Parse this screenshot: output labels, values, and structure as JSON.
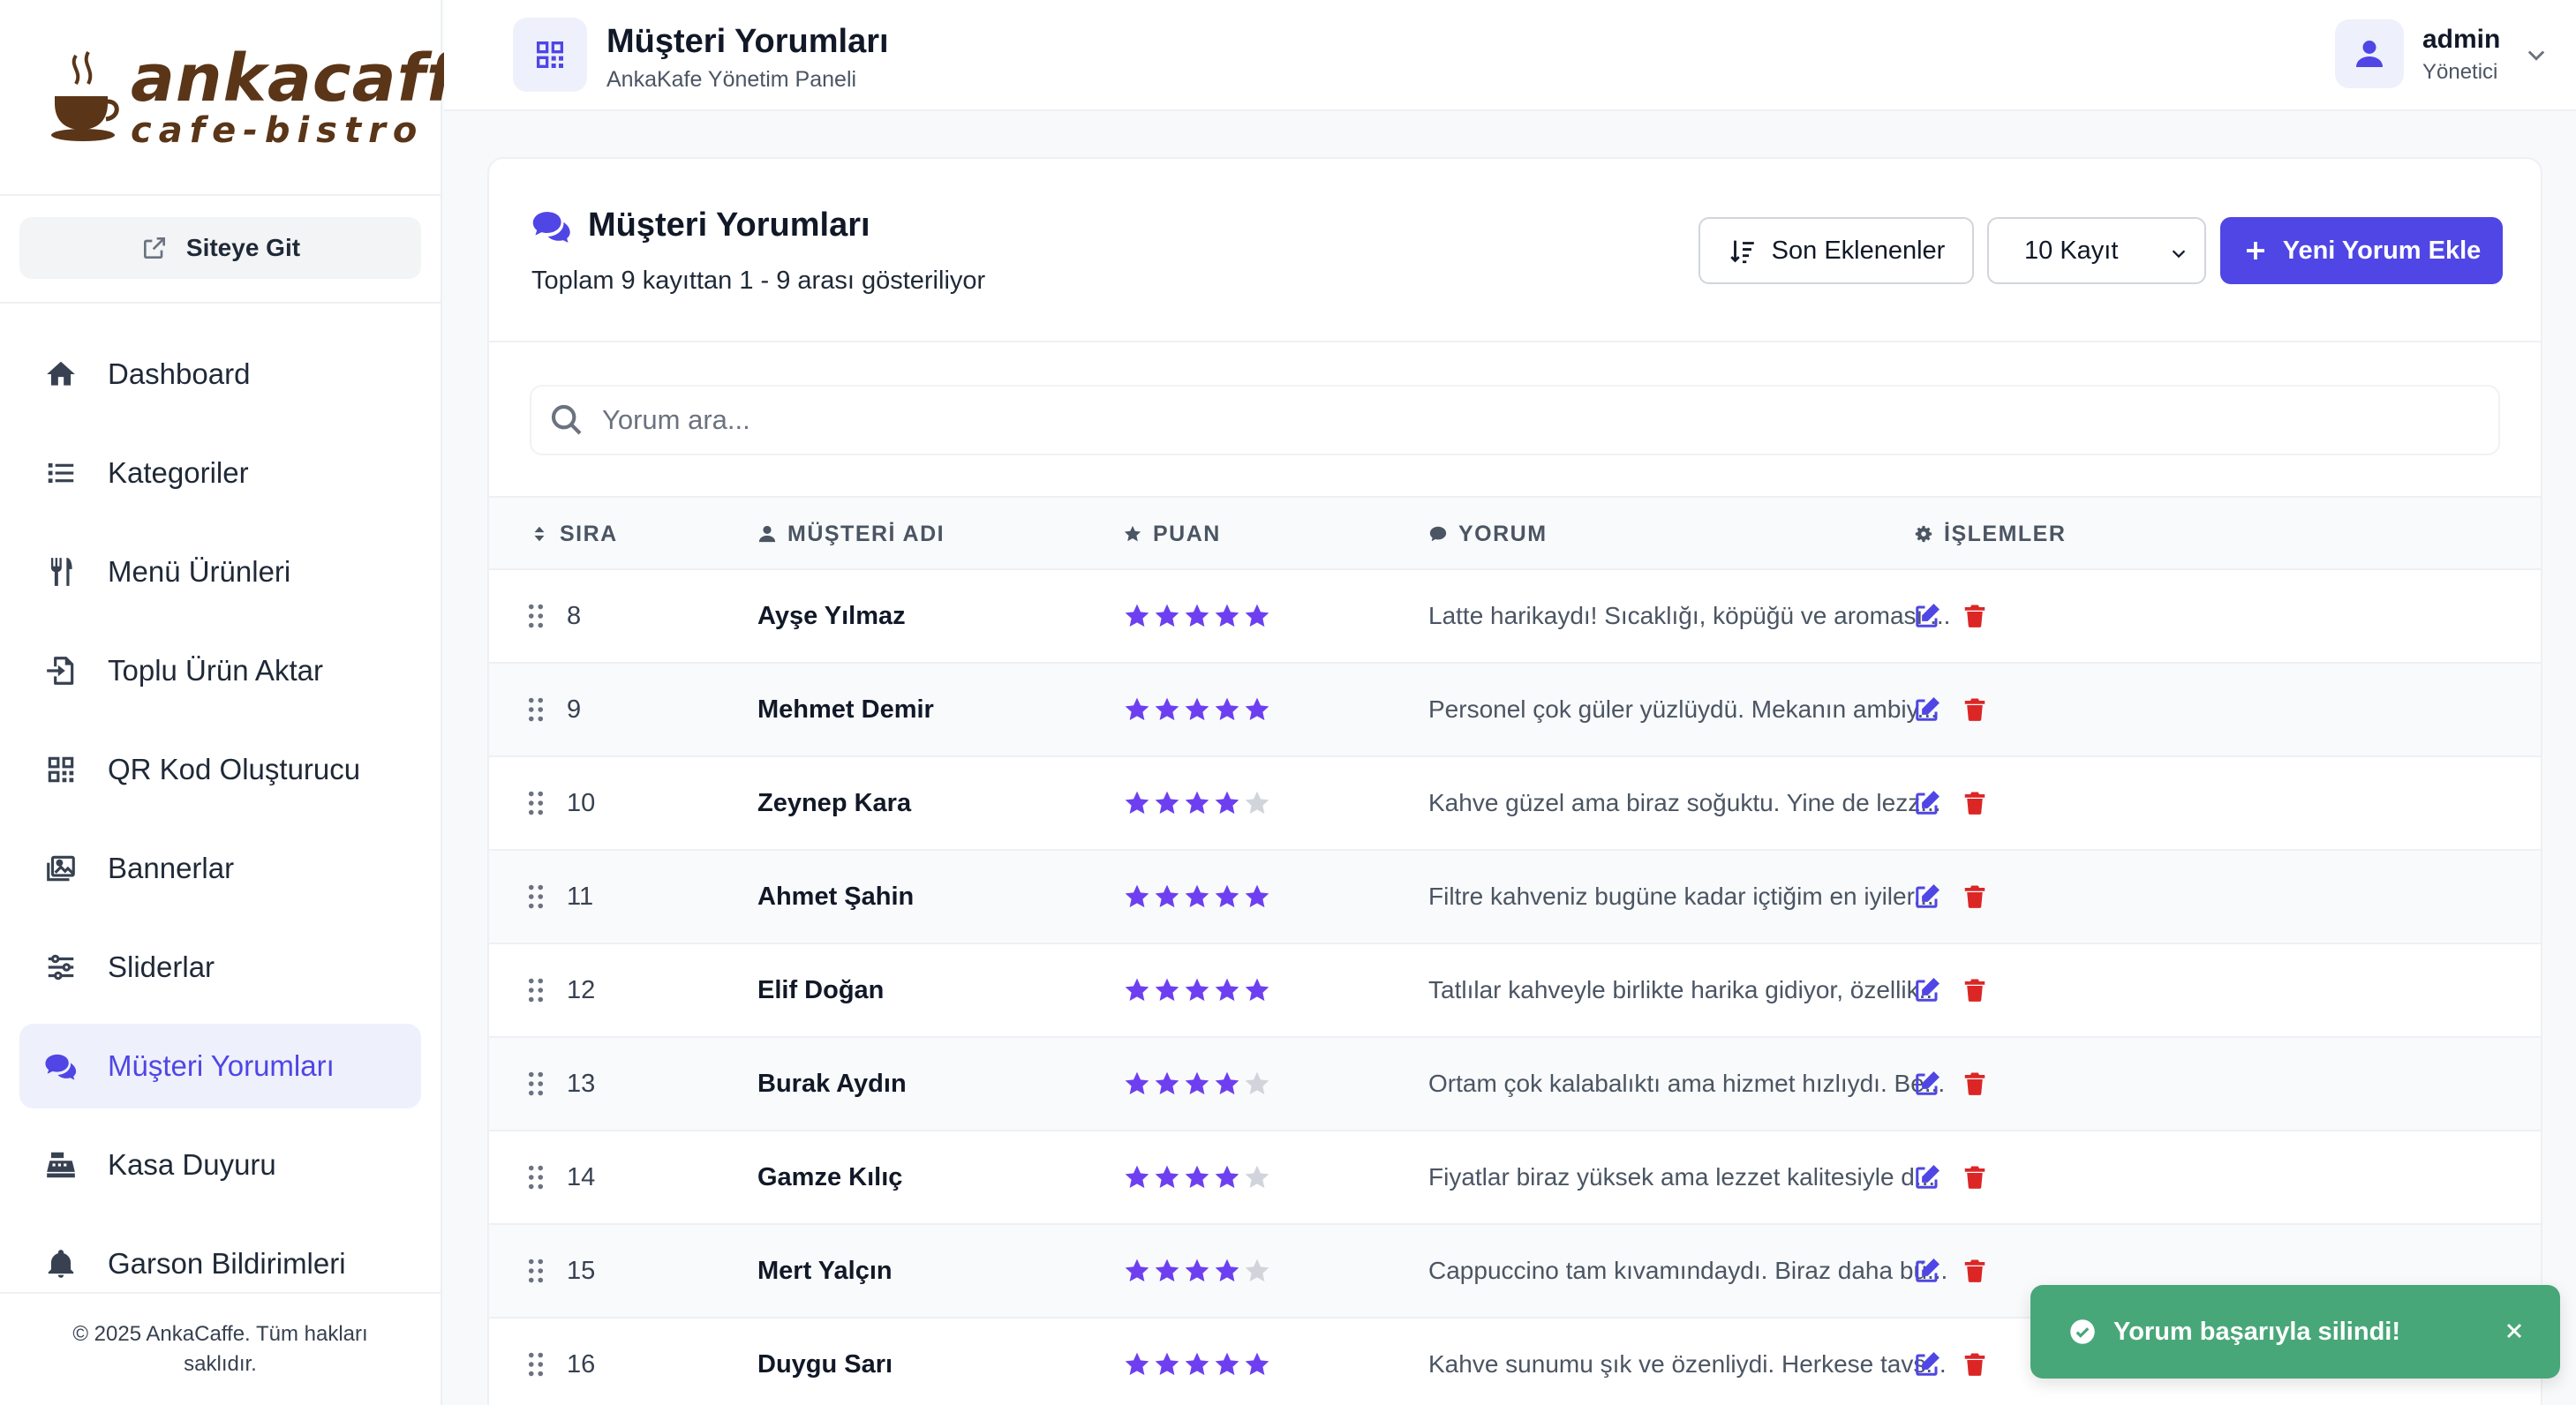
{
  "brand": {
    "line1": "ankacaffe",
    "line2": "cafe-bistro"
  },
  "sidebar": {
    "site_button": "Siteye Git",
    "items": [
      {
        "label": "Dashboard",
        "icon": "home-icon"
      },
      {
        "label": "Kategoriler",
        "icon": "list-icon"
      },
      {
        "label": "Menü Ürünleri",
        "icon": "utensils-icon"
      },
      {
        "label": "Toplu Ürün Aktar",
        "icon": "file-import-icon"
      },
      {
        "label": "QR Kod Oluşturucu",
        "icon": "qrcode-icon"
      },
      {
        "label": "Bannerlar",
        "icon": "images-icon"
      },
      {
        "label": "Sliderlar",
        "icon": "sliders-icon"
      },
      {
        "label": "Müşteri Yorumları",
        "icon": "comments-icon",
        "active": true
      },
      {
        "label": "Kasa Duyuru",
        "icon": "cash-register-icon"
      },
      {
        "label": "Garson Bildirimleri",
        "icon": "bell-icon"
      }
    ],
    "footer": "© 2025 AnkaCaffe. Tüm hakları saklıdır."
  },
  "header": {
    "title": "Müşteri Yorumları",
    "subtitle": "AnkaKafe Yönetim Paneli",
    "user_name": "admin",
    "user_role": "Yönetici"
  },
  "card": {
    "title": "Müşteri Yorumları",
    "subtitle": "Toplam 9 kayıttan 1 - 9 arası gösteriliyor",
    "sort_label": "Son Eklenenler",
    "count_select": "10 Kayıt",
    "add_label": "Yeni Yorum Ekle",
    "search_placeholder": "Yorum ara..."
  },
  "table": {
    "headers": {
      "order": "SIRA",
      "name": "MÜŞTERİ ADI",
      "rating": "PUAN",
      "comment": "YORUM",
      "actions": "İŞLEMLER"
    },
    "rows": [
      {
        "order": "8",
        "name": "Ayşe Yılmaz",
        "rating": 5,
        "comment": "Latte harikaydı! Sıcaklığı, köpüğü ve aroması ..."
      },
      {
        "order": "9",
        "name": "Mehmet Demir",
        "rating": 5,
        "comment": "Personel çok güler yüzlüydü. Mekanın ambiy..."
      },
      {
        "order": "10",
        "name": "Zeynep Kara",
        "rating": 4,
        "comment": "Kahve güzel ama biraz soğuktu. Yine de lezz..."
      },
      {
        "order": "11",
        "name": "Ahmet Şahin",
        "rating": 5,
        "comment": "Filtre kahveniz bugüne kadar içtiğim en iyiler..."
      },
      {
        "order": "12",
        "name": "Elif Doğan",
        "rating": 5,
        "comment": "Tatlılar kahveyle birlikte harika gidiyor, özellik..."
      },
      {
        "order": "13",
        "name": "Burak Aydın",
        "rating": 4,
        "comment": "Ortam çok kalabalıktı ama hizmet hızlıydı. Be..."
      },
      {
        "order": "14",
        "name": "Gamze Kılıç",
        "rating": 4,
        "comment": "Fiyatlar biraz yüksek ama lezzet kalitesiyle d..."
      },
      {
        "order": "15",
        "name": "Mert Yalçın",
        "rating": 4,
        "comment": "Cappuccino tam kıvamındaydı. Biraz daha bü..."
      },
      {
        "order": "16",
        "name": "Duygu Sarı",
        "rating": 5,
        "comment": "Kahve sunumu şık ve özenliydi. Herkese tavs..."
      }
    ]
  },
  "toast": {
    "message": "Yorum başarıyla silindi!"
  },
  "colors": {
    "accent": "#4f46e5",
    "star": "#6d3ff0",
    "star_empty": "#d1d5db",
    "delete": "#dc2626",
    "toast": "#48a779",
    "brand": "#5a3518"
  }
}
